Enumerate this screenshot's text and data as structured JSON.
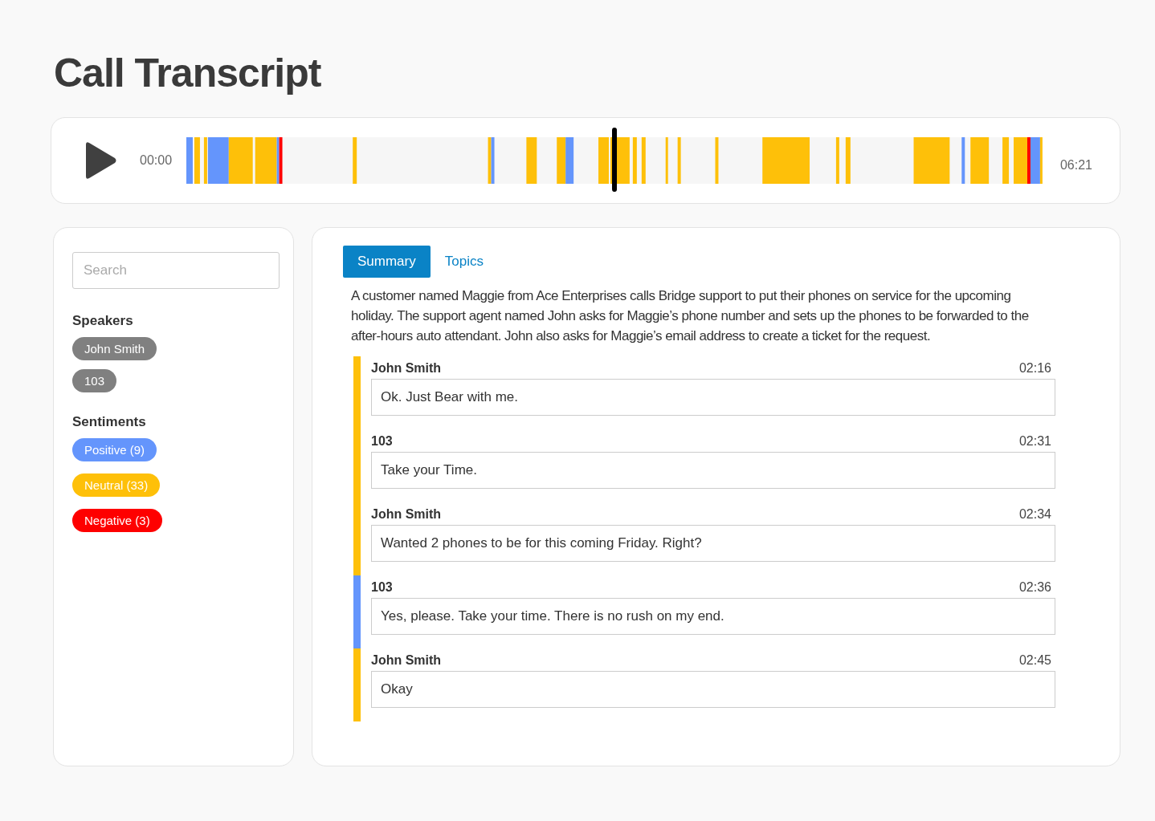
{
  "page": {
    "title": "Call Transcript"
  },
  "player": {
    "start_time": "00:00",
    "end_time": "06:21",
    "level": 0.5
  },
  "sidebar": {
    "search": {
      "placeholder": "Search"
    },
    "speakers_heading": "Speakers",
    "speakers": [
      "John Smith",
      "103"
    ],
    "sentiments_heading": "Sentiments",
    "sentiments": [
      {
        "label": "Positive (9)",
        "color": "#6495fc"
      },
      {
        "label": "Neutral (33)",
        "color": "#fec009"
      },
      {
        "label": "Negative (3)",
        "color": "#fe0000"
      }
    ]
  },
  "tabs": [
    {
      "label": "Summary",
      "selected": true
    },
    {
      "label": "Topics",
      "selected": false
    }
  ],
  "summary": "A customer named Maggie from Ace Enterprises calls Bridge support to put their phones on service for the upcoming holiday. The support agent named John asks for Maggie’s phone number and sets up the phones to be forwarded to the after-hours auto attendant. John also asks for Maggie’s email address to create a ticket for the request.",
  "transcript": [
    {
      "speaker": "John Smith",
      "time": "02:16",
      "text": "Ok. Just Bear with me.",
      "color": "#fec009"
    },
    {
      "speaker": "103",
      "time": "02:31",
      "text": "Take your Time.",
      "color": "#fec009"
    },
    {
      "speaker": "John Smith",
      "time": "02:34",
      "text": "Wanted 2 phones to be for this coming  Friday.  Right?",
      "color": "#fec009"
    },
    {
      "speaker": "103",
      "time": "02:36",
      "text": "Yes, please. Take your time. There is no rush on my end.",
      "color": "#6495fc"
    },
    {
      "speaker": "John Smith",
      "time": "02:45",
      "text": "Okay",
      "color": "#fec009"
    }
  ]
}
